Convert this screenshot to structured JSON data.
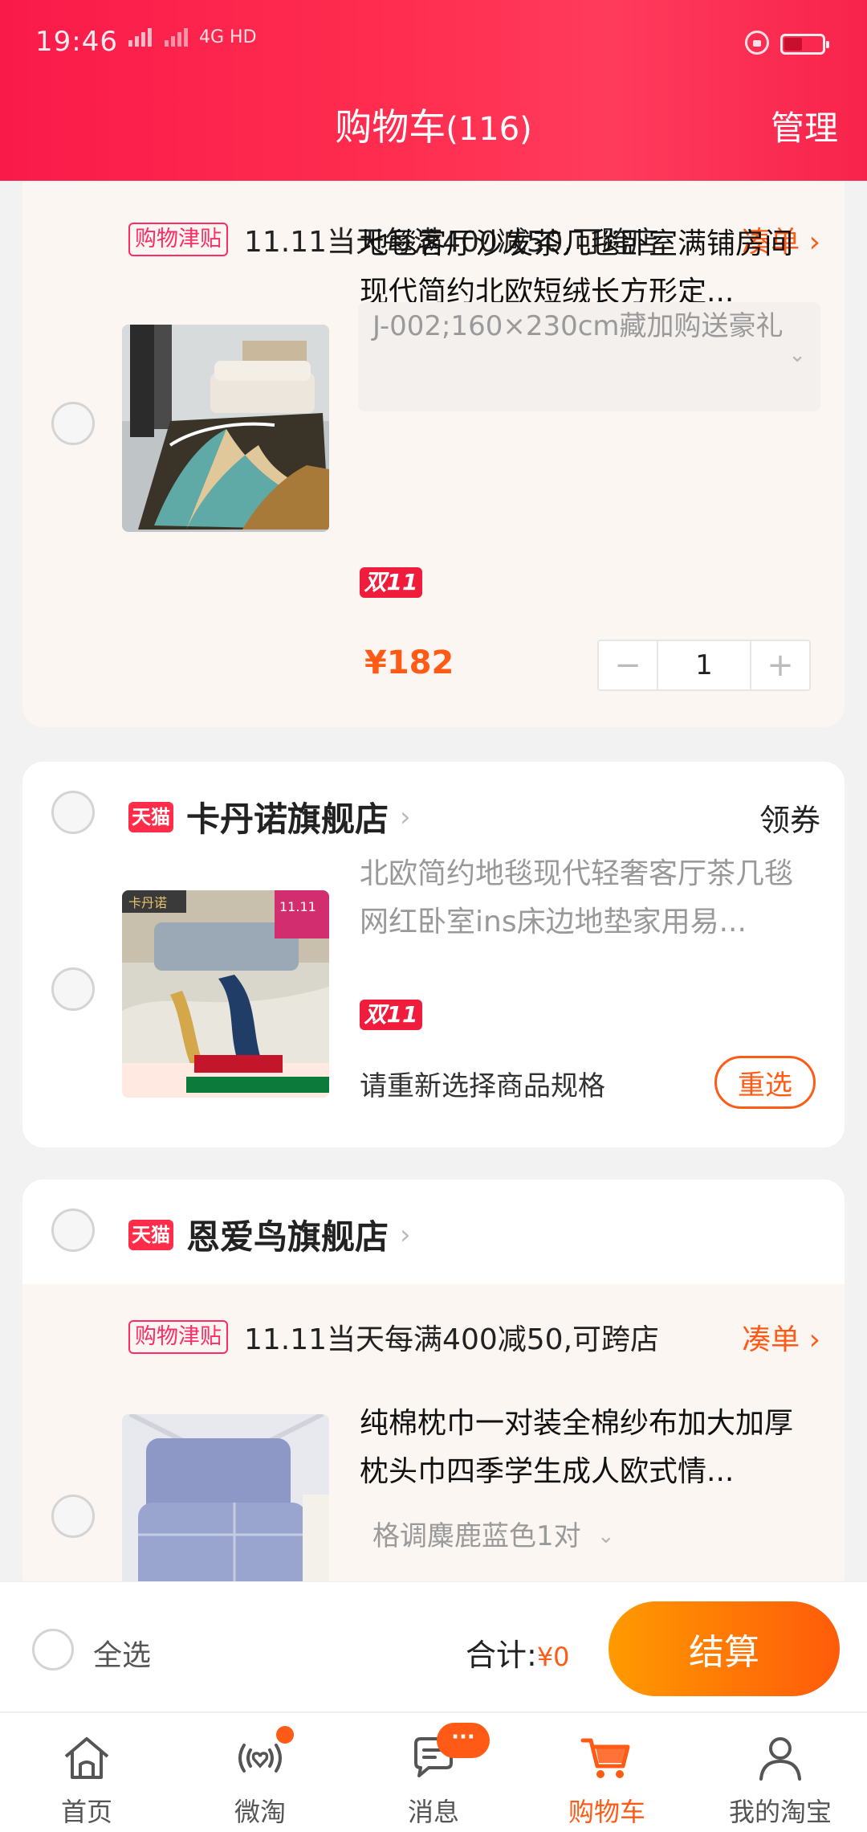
{
  "status": {
    "time": "19:46",
    "network": "4G HD"
  },
  "header": {
    "title": "购物车",
    "count": "(116)",
    "manage": "管理"
  },
  "card1": {
    "promo_tag": "购物津贴",
    "promo_text": "11.11当天每满400减50,可跨店",
    "promo_link": "凑单",
    "product_name": "地毯客厅沙发茶几毯卧室满铺房间现代简约北欧短绒长方形定...",
    "sku": "J-002;160×230cm藏加购送豪礼",
    "badge": "双11",
    "price": "¥182",
    "qty": "1"
  },
  "card2": {
    "shop_tag": "天猫",
    "shop_name": "卡丹诺旗舰店",
    "coupon": "领券",
    "product_name": "北欧简约地毯现代轻奢客厅茶几毯网红卧室ins床边地垫家用易...",
    "badge": "双11",
    "reselect_text": "请重新选择商品规格",
    "reselect_btn": "重选"
  },
  "card3": {
    "shop_tag": "天猫",
    "shop_name": "恩爱鸟旗舰店",
    "promo_tag": "购物津贴",
    "promo_text": "11.11当天每满400减50,可跨店",
    "promo_link": "凑单",
    "product_name": "纯棉枕巾一对装全棉纱布加大加厚枕头巾四季学生成人欧式情...",
    "sku": "格调麋鹿蓝色1对"
  },
  "checkout": {
    "select_all": "全选",
    "total_label": "合计:",
    "total_amount": "¥0",
    "button": "结算"
  },
  "tabs": [
    {
      "label": "首页"
    },
    {
      "label": "微淘"
    },
    {
      "label": "消息",
      "badge": "···"
    },
    {
      "label": "购物车"
    },
    {
      "label": "我的淘宝"
    }
  ],
  "colors": {
    "accent": "#ff5b16",
    "header": "#ff2d4f",
    "tmall": "#ff2d4a"
  }
}
